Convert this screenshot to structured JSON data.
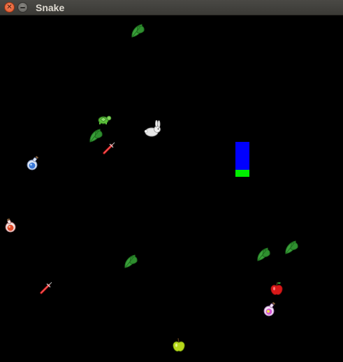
{
  "window": {
    "title": "Snake",
    "close_icon": "close-icon",
    "minimize_icon": "minimize-icon"
  },
  "game": {
    "background": "#000000",
    "snake": {
      "head_color": "#00ee00",
      "body_color": "#0000ff"
    },
    "items": [
      {
        "type": "leaf",
        "icon": "leaf-icon"
      },
      {
        "type": "turtle",
        "icon": "turtle-icon"
      },
      {
        "type": "leaf",
        "icon": "leaf-icon"
      },
      {
        "type": "rabbit",
        "icon": "rabbit-icon"
      },
      {
        "type": "syringe",
        "icon": "syringe-icon"
      },
      {
        "type": "potion-blue",
        "icon": "potion-icon"
      },
      {
        "type": "potion-red",
        "icon": "potion-icon"
      },
      {
        "type": "leaf",
        "icon": "leaf-icon"
      },
      {
        "type": "leaf",
        "icon": "leaf-icon"
      },
      {
        "type": "leaf",
        "icon": "leaf-icon"
      },
      {
        "type": "syringe",
        "icon": "syringe-icon"
      },
      {
        "type": "apple-red",
        "icon": "apple-icon"
      },
      {
        "type": "potion-purple",
        "icon": "potion-icon"
      },
      {
        "type": "apple-green",
        "icon": "apple-icon"
      }
    ]
  }
}
